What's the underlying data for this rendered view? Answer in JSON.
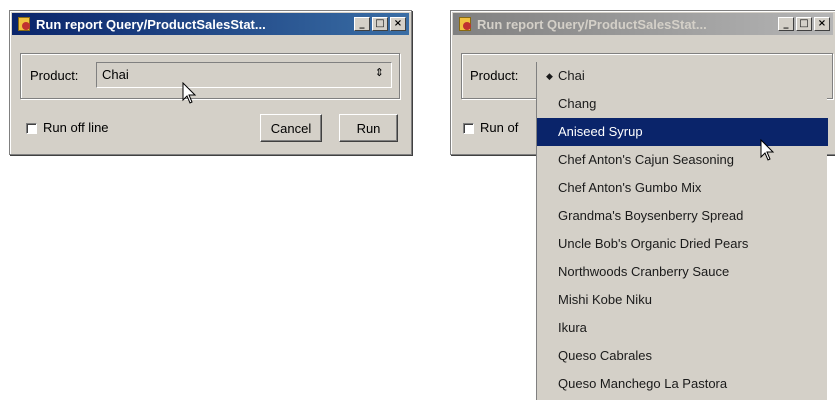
{
  "left_window": {
    "title": "Run report Query/ProductSalesStat...",
    "titlebar_buttons": [
      "_",
      "□",
      "×"
    ],
    "product_label": "Product:",
    "product_value": "Chai",
    "run_offline_label": "Run off line",
    "cancel_label": "Cancel",
    "run_label": "Run"
  },
  "right_window": {
    "title": "Run report Query/ProductSalesStat...",
    "titlebar_buttons": [
      "_",
      "□",
      "×"
    ],
    "product_label": "Product:",
    "run_offline_label": "Run of"
  },
  "dropdown": {
    "items": [
      "Chai",
      "Chang",
      "Aniseed Syrup",
      "Chef Anton's Cajun Seasoning",
      "Chef Anton's Gumbo Mix",
      "Grandma's Boysenberry Spread",
      "Uncle Bob's Organic Dried Pears",
      "Northwoods Cranberry Sauce",
      "Mishi Kobe Niku",
      "Ikura",
      "Queso Cabrales",
      "Queso Manchego La Pastora"
    ],
    "checked_item": "Chai",
    "highlighted_item": "Aniseed Syrup"
  },
  "colors": {
    "active_titlebar": "#0a246a",
    "inactive_titlebar": "#808080",
    "face": "#d4d0c8",
    "selection": "#0a246a"
  }
}
